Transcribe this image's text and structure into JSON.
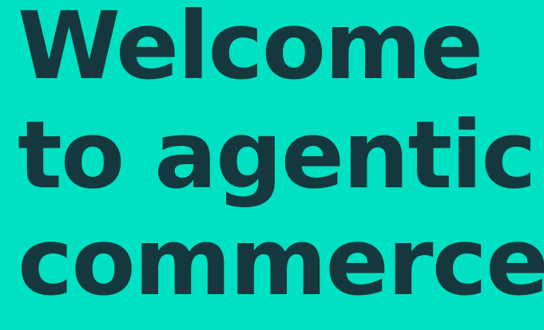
{
  "hero": {
    "headline": {
      "line1": "Welcome",
      "line2": "to agentic",
      "line3": "commerce"
    },
    "colors": {
      "background": "#00E0C3",
      "text": "#14383D"
    }
  }
}
